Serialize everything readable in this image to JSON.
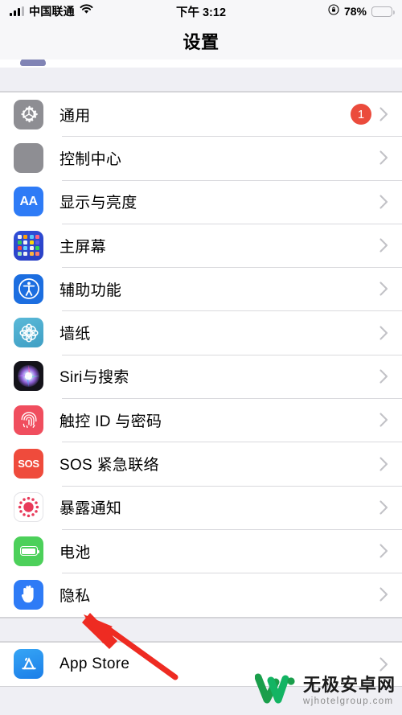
{
  "status_bar": {
    "carrier": "中国联通",
    "signal_icon": "cellular-signal-icon",
    "wifi_icon": "wifi-icon",
    "time": "下午 3:12",
    "rotation_lock_icon": "rotation-lock-icon",
    "battery_percent": "78%",
    "battery_level": 78,
    "battery_color": "#f9cf44"
  },
  "nav": {
    "title": "设置"
  },
  "groups": [
    {
      "rows": [
        {
          "label": "通用",
          "icon": "gear-icon",
          "badge": "1",
          "chevron": "chevron-right-icon"
        },
        {
          "label": "控制中心",
          "icon": "control-center-icon",
          "badge": null,
          "chevron": "chevron-right-icon"
        },
        {
          "label": "显示与亮度",
          "icon": "aa-text-icon",
          "badge": null,
          "chevron": "chevron-right-icon"
        },
        {
          "label": "主屏幕",
          "icon": "home-screen-grid-icon",
          "badge": null,
          "chevron": "chevron-right-icon"
        },
        {
          "label": "辅助功能",
          "icon": "accessibility-icon",
          "badge": null,
          "chevron": "chevron-right-icon"
        },
        {
          "label": "墙纸",
          "icon": "wallpaper-flower-icon",
          "badge": null,
          "chevron": "chevron-right-icon"
        },
        {
          "label": "Siri与搜索",
          "icon": "siri-orb-icon",
          "badge": null,
          "chevron": "chevron-right-icon"
        },
        {
          "label": "触控 ID 与密码",
          "icon": "fingerprint-icon",
          "badge": null,
          "chevron": "chevron-right-icon"
        },
        {
          "label": "SOS 紧急联络",
          "icon": "sos-icon",
          "badge": null,
          "chevron": "chevron-right-icon"
        },
        {
          "label": "暴露通知",
          "icon": "exposure-notification-icon",
          "badge": null,
          "chevron": "chevron-right-icon"
        },
        {
          "label": "电池",
          "icon": "battery-icon",
          "badge": null,
          "chevron": "chevron-right-icon"
        },
        {
          "label": "隐私",
          "icon": "privacy-hand-icon",
          "badge": null,
          "chevron": "chevron-right-icon"
        }
      ]
    },
    {
      "rows": [
        {
          "label": "App Store",
          "icon": "app-store-icon",
          "badge": null,
          "chevron": "chevron-right-icon"
        }
      ]
    }
  ],
  "annotation": {
    "type": "arrow",
    "color": "#ee2b22",
    "points_to": "电池"
  },
  "watermark": {
    "logo_icon": "w-logo-icon",
    "name": "无极安卓网",
    "url": "wjhotelgroup.com",
    "color": "#16a34a"
  }
}
